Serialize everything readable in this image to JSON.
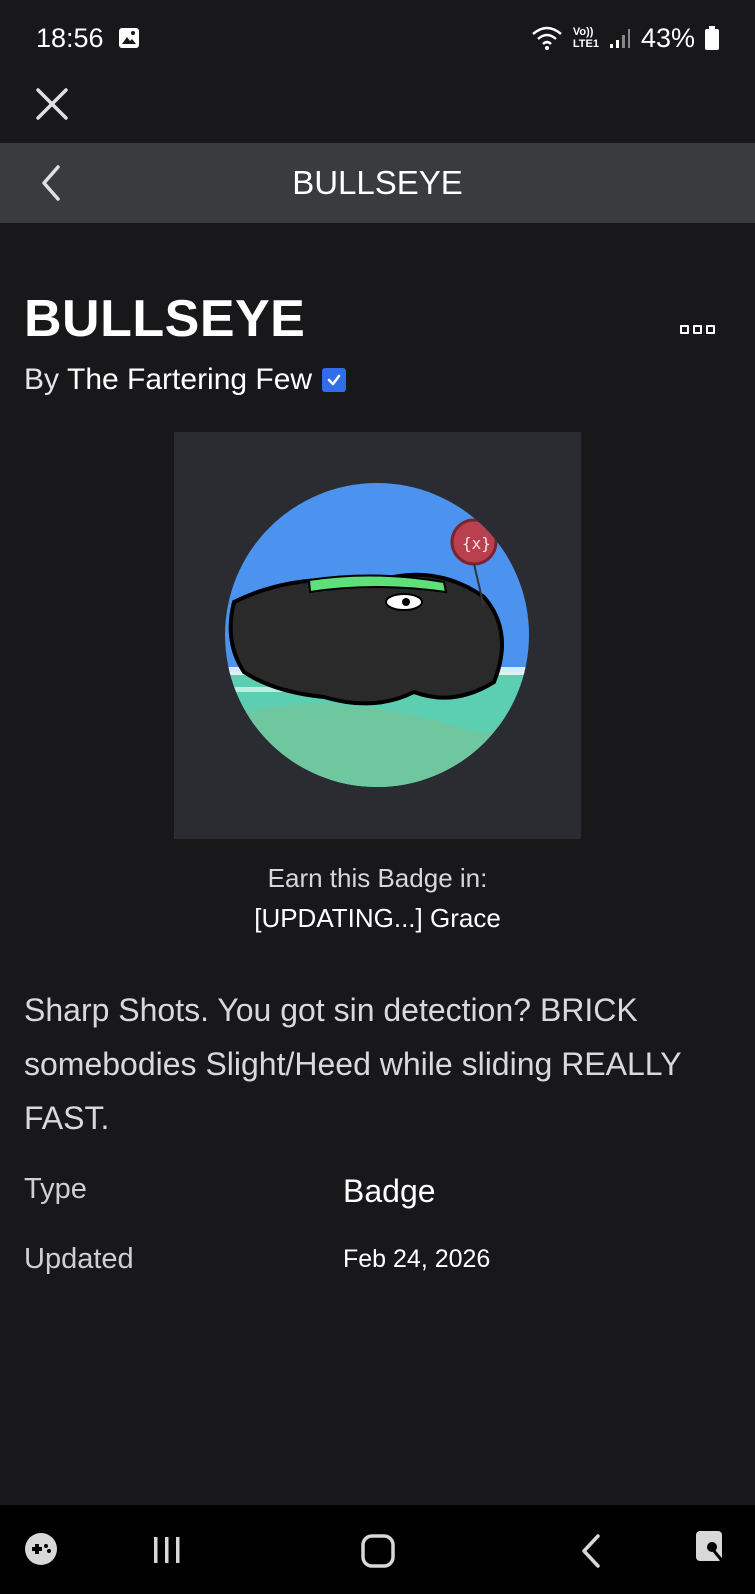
{
  "status_bar": {
    "time": "18:56",
    "battery": "43%",
    "network": "LTE1",
    "volte": "Vo))"
  },
  "header": {
    "title": "BULLSEYE"
  },
  "badge": {
    "title": "BULLSEYE",
    "by_prefix": "By",
    "creator": "The Fartering Few",
    "earn_label": "Earn this Badge in:",
    "earn_game": "[UPDATING...] Grace",
    "description": "Sharp Shots. You got sin detection? BRICK somebodies Slight/Heed while sliding REALLY FAST."
  },
  "details": {
    "type_label": "Type",
    "type_value": "Badge",
    "updated_label": "Updated",
    "updated_value": "Feb 24, 2026"
  },
  "colors": {
    "background": "#18181b",
    "nav_bar": "#393b3d",
    "verified": "#2f6ee8"
  }
}
